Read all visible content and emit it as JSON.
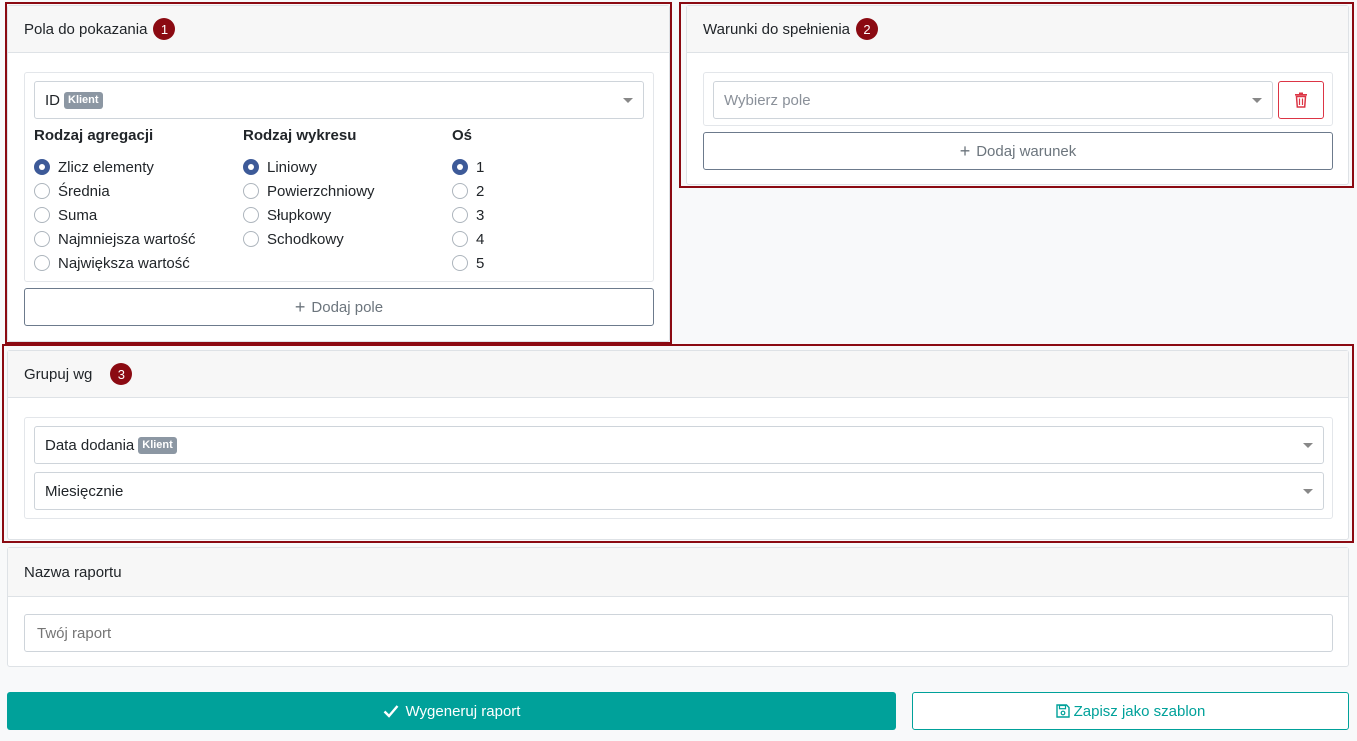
{
  "fields_panel": {
    "title": "Pola do pokazania",
    "badge": "1",
    "selected_field": "ID",
    "selected_field_tag": "Klient",
    "aggregation": {
      "title": "Rodzaj agregacji",
      "options": [
        "Zlicz elementy",
        "Średnia",
        "Suma",
        "Najmniejsza wartość",
        "Największa wartość"
      ],
      "selected": "Zlicz elementy"
    },
    "chart_type": {
      "title": "Rodzaj wykresu",
      "options": [
        "Liniowy",
        "Powierzchniowy",
        "Słupkowy",
        "Schodkowy"
      ],
      "selected": "Liniowy"
    },
    "axis": {
      "title": "Oś",
      "options": [
        "1",
        "2",
        "3",
        "4",
        "5"
      ],
      "selected": "1"
    },
    "add_button": "Dodaj pole"
  },
  "conditions_panel": {
    "title": "Warunki do spełnienia",
    "badge": "2",
    "select_placeholder": "Wybierz pole",
    "add_button": "Dodaj warunek"
  },
  "group_panel": {
    "title": "Grupuj wg",
    "badge": "3",
    "field_value": "Data dodania",
    "field_tag": "Klient",
    "interval_value": "Miesięcznie"
  },
  "name_panel": {
    "title": "Nazwa raportu",
    "input_placeholder": "Twój raport"
  },
  "actions": {
    "generate": "Wygeneruj raport",
    "save_template": "Zapisz jako szablon"
  },
  "colors": {
    "accent": "#00a19a",
    "highlight": "#8b0a12",
    "radio_checked": "#3d5a98"
  }
}
